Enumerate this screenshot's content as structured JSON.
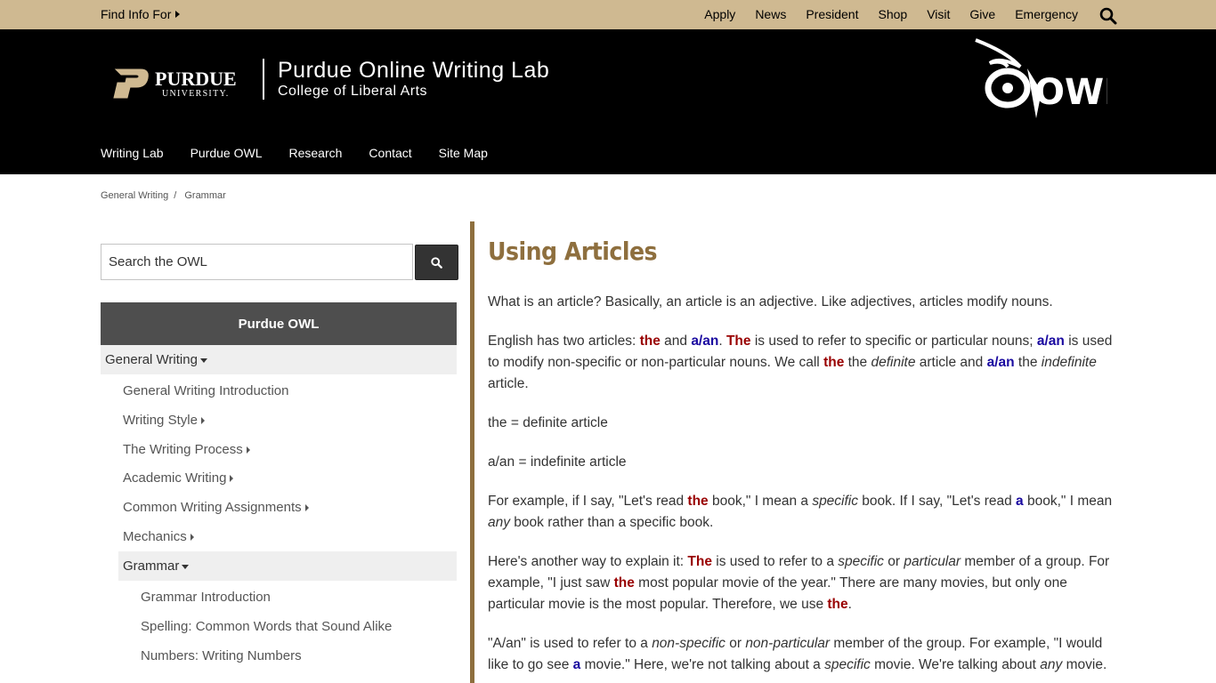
{
  "topbar": {
    "find_info": "Find Info For",
    "links": [
      "Apply",
      "News",
      "President",
      "Shop",
      "Visit",
      "Give",
      "Emergency"
    ]
  },
  "header": {
    "purdue_wordmark": "PURDUE",
    "purdue_university": "UNIVERSITY.",
    "site_title": "Purdue Online Writing Lab",
    "site_subtitle": "College of Liberal Arts",
    "owl_logo_text": "OWL",
    "nav": [
      "Writing Lab",
      "Purdue OWL",
      "Research",
      "Contact",
      "Site Map"
    ]
  },
  "breadcrumb": [
    "General Writing",
    "Grammar"
  ],
  "sidebar": {
    "search_placeholder": "Search the OWL",
    "heading": "Purdue OWL",
    "section": "General Writing",
    "items": [
      {
        "label": "General Writing Introduction",
        "expandable": false
      },
      {
        "label": "Writing Style",
        "expandable": true
      },
      {
        "label": "The Writing Process",
        "expandable": true
      },
      {
        "label": "Academic Writing",
        "expandable": true
      },
      {
        "label": "Common Writing Assignments",
        "expandable": true
      },
      {
        "label": "Mechanics",
        "expandable": true
      }
    ],
    "subsection": "Grammar",
    "sub_items": [
      "Grammar Introduction",
      "Spelling: Common Words that Sound Alike",
      "Numbers: Writing Numbers"
    ]
  },
  "content": {
    "title": "Using Articles",
    "p1": "What is an article? Basically, an article is an adjective. Like adjectives, articles modify nouns.",
    "p3": "the = definite article",
    "p4": "a/an = indefinite article"
  },
  "colors": {
    "gold": "#cfb991",
    "heading_gold": "#8e6f3e",
    "red_term": "#990000",
    "blue_term": "#1a0aa0"
  }
}
